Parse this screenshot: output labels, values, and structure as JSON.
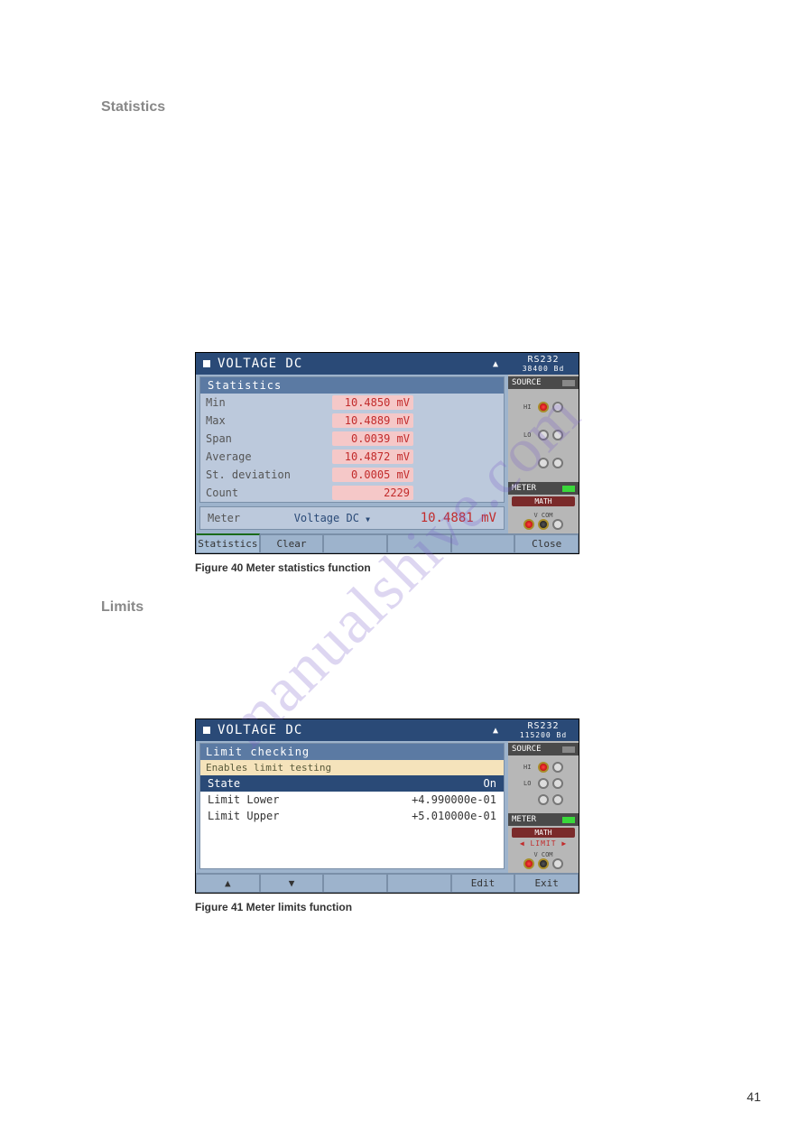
{
  "page_number": "41",
  "watermark": "manualshive.com",
  "section1": {
    "heading": "Statistics"
  },
  "section2": {
    "heading": "Limits"
  },
  "fig40": {
    "caption": "Figure 40 Meter statistics function",
    "title": "VOLTAGE  DC",
    "warn": "▲",
    "sub_head": "Statistics",
    "rows": [
      {
        "label": "Min",
        "value": "10.4850 mV"
      },
      {
        "label": "Max",
        "value": "10.4889 mV"
      },
      {
        "label": "Span",
        "value": "0.0039 mV"
      },
      {
        "label": "Average",
        "value": "10.4872 mV"
      },
      {
        "label": "St. deviation",
        "value": "0.0005 mV"
      },
      {
        "label": "Count",
        "value": "2229"
      }
    ],
    "meter_label": "Meter",
    "meter_dd": "Voltage DC",
    "meter_value": "10.4881  mV",
    "buttons": {
      "b1": "Statistics",
      "b2": "Clear",
      "b6": "Close"
    },
    "side": {
      "conn": "RS232",
      "baud": "38400 Bd",
      "source": "SOURCE",
      "meter": "METER",
      "math": "MATH",
      "hi": "HI",
      "lo": "LO",
      "vcom": "V  COM"
    }
  },
  "fig41": {
    "caption": "Figure 41 Meter limits function",
    "title": "VOLTAGE  DC",
    "warn": "▲",
    "panel_head": "Limit checking",
    "help": "Enables limit testing",
    "rows": [
      {
        "label": "State",
        "value": "On",
        "selected": true
      },
      {
        "label": "Limit Lower",
        "value": "+4.990000e-01",
        "selected": false
      },
      {
        "label": "Limit Upper",
        "value": "+5.010000e-01",
        "selected": false
      }
    ],
    "buttons": {
      "up": "▲",
      "down": "▼",
      "edit": "Edit",
      "exit": "Exit"
    },
    "side": {
      "conn": "RS232",
      "baud": "115200 Bd",
      "source": "SOURCE",
      "meter": "METER",
      "math": "MATH",
      "limit": "◀ LIMIT ▶",
      "hi": "HI",
      "lo": "LO",
      "vcom": "V  COM"
    }
  }
}
